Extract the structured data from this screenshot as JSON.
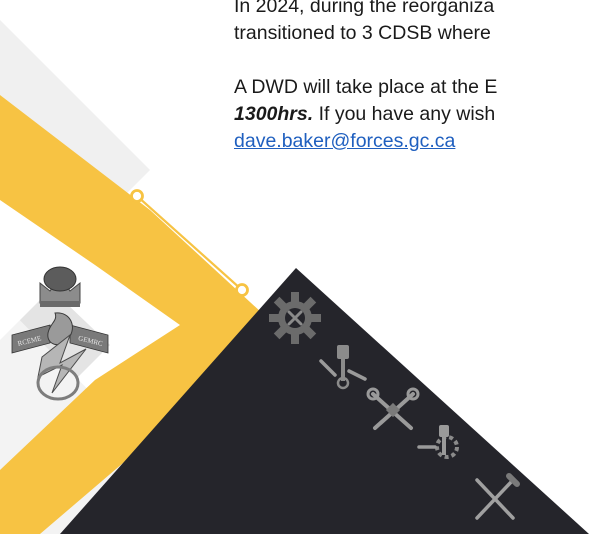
{
  "text": {
    "para1_line1": "In 2024, during the reorganiza",
    "para1_line2": "transitioned to 3 CDSB where",
    "para2_line1": "A DWD will take place at the E",
    "para2_time": "1300hrs.",
    "para2_line2_rest": " If you have any wish",
    "email": "dave.baker@forces.gc.ca"
  },
  "badge": {
    "left_scroll_text": "RCEME",
    "right_scroll_text": "GEMRC"
  },
  "colors": {
    "accent_yellow": "#f7c343",
    "dark_panel": "#25252b",
    "link_blue": "#1f5fbf",
    "light_grey": "#ececec",
    "mid_grey": "#d6d6d6"
  },
  "icons": [
    "gear-wrench-icon",
    "piston-wrench-icon",
    "crossed-wrench-icon",
    "piston-gear-icon",
    "crossed-tools-icon"
  ]
}
